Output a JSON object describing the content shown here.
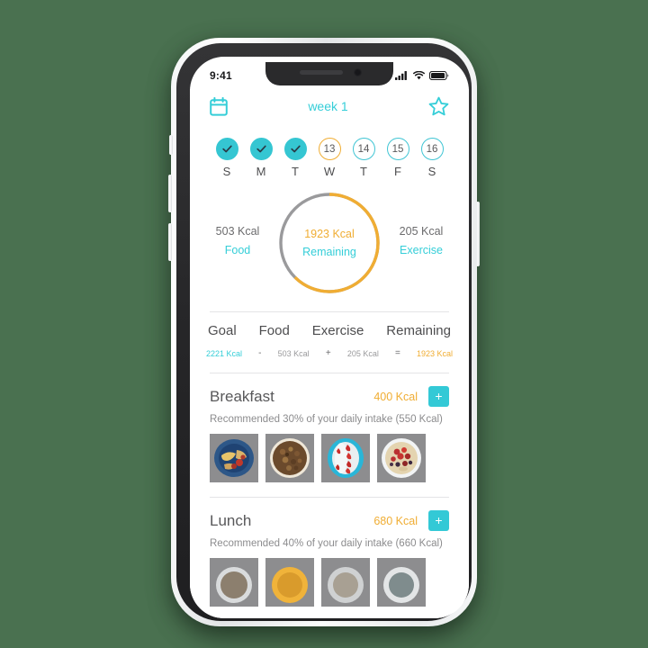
{
  "background_color": "#4a7150",
  "theme": {
    "teal": "#35c6d2",
    "orange": "#f0ad33",
    "gray_text": "#58585a",
    "muted_text": "#8c8c8e"
  },
  "phone": {
    "status_bar": {
      "time": "9:41",
      "icons": [
        "signal-bars-icon",
        "wifi-icon",
        "battery-icon"
      ]
    }
  },
  "app": {
    "topbar": {
      "calendar_icon": "calendar-icon",
      "title": "week 1",
      "star_icon": "star-icon"
    },
    "days": [
      {
        "letter": "S",
        "label": "",
        "state": "done"
      },
      {
        "letter": "M",
        "label": "",
        "state": "done"
      },
      {
        "letter": "T",
        "label": "",
        "state": "done"
      },
      {
        "letter": "W",
        "label": "13",
        "state": "today"
      },
      {
        "letter": "T",
        "label": "14",
        "state": "future"
      },
      {
        "letter": "F",
        "label": "15",
        "state": "future"
      },
      {
        "letter": "S",
        "label": "16",
        "state": "future"
      }
    ],
    "ring": {
      "center_value": "1923 Kcal",
      "center_caption": "Remaining",
      "left_value": "503 Kcal",
      "left_caption": "Food",
      "right_value": "205 Kcal",
      "right_caption": "Exercise",
      "progress_color": "#f0ad33",
      "track_color": "#9a9a9c",
      "progress_degrees": 225
    },
    "summary": {
      "headers": [
        "Goal",
        "Food",
        "Exercise",
        "Remaining"
      ],
      "goal": "2221 Kcal",
      "op_minus": "-",
      "food": "503 Kcal",
      "op_plus": "+",
      "exercise": "205 Kcal",
      "op_equals": "=",
      "remaining": "1923 Kcal"
    },
    "meals": [
      {
        "name": "Breakfast",
        "kcal": "400 Kcal",
        "add_label": "+",
        "recommendation": "Recommended 30% of your daily intake (550 Kcal)",
        "thumbs": [
          "plate-eggs-icon",
          "granola-bowl-icon",
          "strawberry-bowl-icon",
          "berry-oats-icon"
        ]
      },
      {
        "name": "Lunch",
        "kcal": "680 Kcal",
        "add_label": "+",
        "recommendation": "Recommended 40% of your daily intake (660 Kcal)",
        "thumbs": [
          "lunch-thumb-1-icon",
          "lunch-thumb-2-icon",
          "lunch-thumb-3-icon",
          "lunch-thumb-4-icon"
        ]
      }
    ]
  }
}
